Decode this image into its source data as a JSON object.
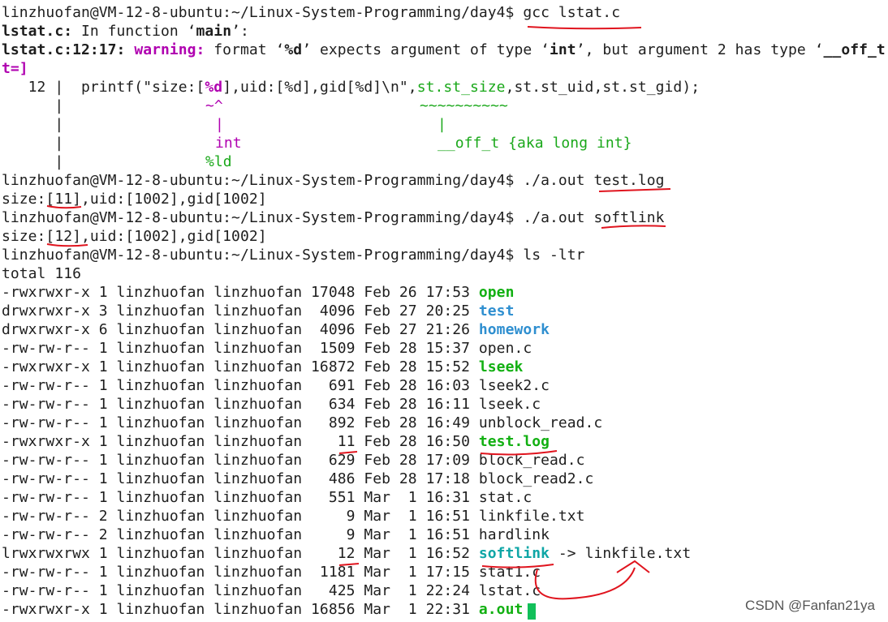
{
  "terminal": {
    "prompt": "linzhuofan@VM-12-8-ubuntu:~/Linux-System-Programming/day4$ ",
    "cmd_gcc": "gcc lstat.c",
    "diag_file_in": "lstat.c:",
    "diag_in_function": " In function ‘",
    "diag_main": "main",
    "diag_close": "’:",
    "warn_loc": "lstat.c:12:17: ",
    "warn_label": "warning: ",
    "warn_msg_1": "format ‘",
    "warn_fmt": "%d",
    "warn_msg_2": "’ expects argument of type ‘",
    "warn_int": "int",
    "warn_msg_3": "’, but argument 2 has type ‘",
    "warn_type_cut": "__off_t",
    "warn_wrap": "t=]",
    "code_line_no": "   12 |  ",
    "code_a": "printf(\"size:[",
    "code_fmt": "%d",
    "code_b": "],uid:[%d],gid[%d]\\n\",",
    "code_arg": "st.st_size",
    "code_c": ",st.st_uid,st.st_gid);",
    "marker_gutter": "      |",
    "marker_caret": "~^",
    "marker_tilde": "~~~~~~~~~~",
    "marker_bar": "|",
    "marker_int": "int",
    "marker_type": "__off_t {aka long int}",
    "marker_fix": "%ld",
    "cmd_run1_a": "./a.out ",
    "cmd_run1_b": "test.log",
    "out1": "size:[11],uid:[1002],gid[1002]",
    "cmd_run2_a": "./a.out ",
    "cmd_run2_b": "softlink",
    "out2": "size:[12],uid:[1002],gid[1002]",
    "cmd_ls": "ls -ltr",
    "total": "total 116",
    "ls_rows": [
      {
        "meta": "-rwxrwxr-x 1 linzhuofan linzhuofan 17048 Feb 26 17:53 ",
        "name": "open",
        "style": "exec"
      },
      {
        "meta": "drwxrwxr-x 3 linzhuofan linzhuofan  4096 Feb 27 20:25 ",
        "name": "test",
        "style": "dir"
      },
      {
        "meta": "drwxrwxr-x 6 linzhuofan linzhuofan  4096 Feb 27 21:26 ",
        "name": "homework",
        "style": "dir"
      },
      {
        "meta": "-rw-rw-r-- 1 linzhuofan linzhuofan  1509 Feb 28 15:37 ",
        "name": "open.c",
        "style": "plain"
      },
      {
        "meta": "-rwxrwxr-x 1 linzhuofan linzhuofan 16872 Feb 28 15:52 ",
        "name": "lseek",
        "style": "exec"
      },
      {
        "meta": "-rw-rw-r-- 1 linzhuofan linzhuofan   691 Feb 28 16:03 ",
        "name": "lseek2.c",
        "style": "plain"
      },
      {
        "meta": "-rw-rw-r-- 1 linzhuofan linzhuofan   634 Feb 28 16:11 ",
        "name": "lseek.c",
        "style": "plain"
      },
      {
        "meta": "-rw-rw-r-- 1 linzhuofan linzhuofan   892 Feb 28 16:49 ",
        "name": "unblock_read.c",
        "style": "plain"
      },
      {
        "meta": "-rwxrwxr-x 1 linzhuofan linzhuofan    11 Feb 28 16:50 ",
        "name": "test.log",
        "style": "exec"
      },
      {
        "meta": "-rw-rw-r-- 1 linzhuofan linzhuofan   629 Feb 28 17:09 ",
        "name": "block_read.c",
        "style": "plain"
      },
      {
        "meta": "-rw-rw-r-- 1 linzhuofan linzhuofan   486 Feb 28 17:18 ",
        "name": "block_read2.c",
        "style": "plain"
      },
      {
        "meta": "-rw-rw-r-- 1 linzhuofan linzhuofan   551 Mar  1 16:31 ",
        "name": "stat.c",
        "style": "plain"
      },
      {
        "meta": "-rw-rw-r-- 2 linzhuofan linzhuofan     9 Mar  1 16:51 ",
        "name": "linkfile.txt",
        "style": "plain"
      },
      {
        "meta": "-rw-rw-r-- 2 linzhuofan linzhuofan     9 Mar  1 16:51 ",
        "name": "hardlink",
        "style": "plain"
      },
      {
        "meta": "lrwxrwxrwx 1 linzhuofan linzhuofan    12 Mar  1 16:52 ",
        "name": "softlink",
        "style": "link",
        "target": " -> linkfile.txt"
      },
      {
        "meta": "-rw-rw-r-- 1 linzhuofan linzhuofan  1181 Mar  1 17:15 ",
        "name": "stat1.c",
        "style": "plain"
      },
      {
        "meta": "-rw-rw-r-- 1 linzhuofan linzhuofan   425 Mar  1 22:24 ",
        "name": "lstat.c",
        "style": "plain"
      },
      {
        "meta": "-rwxrwxr-x 1 linzhuofan linzhuofan 16856 Mar  1 22:31 ",
        "name": "a.out",
        "style": "exec"
      }
    ]
  },
  "watermark": "CSDN @Fanfan21ya",
  "colors": {
    "annotation_red": "#e0141e",
    "exec_green": "#12b012",
    "dir_blue": "#2f8fd0",
    "link_cyan": "#0fa6a6",
    "warning_magenta": "#b000b0",
    "cursor_green": "#12c05a"
  }
}
